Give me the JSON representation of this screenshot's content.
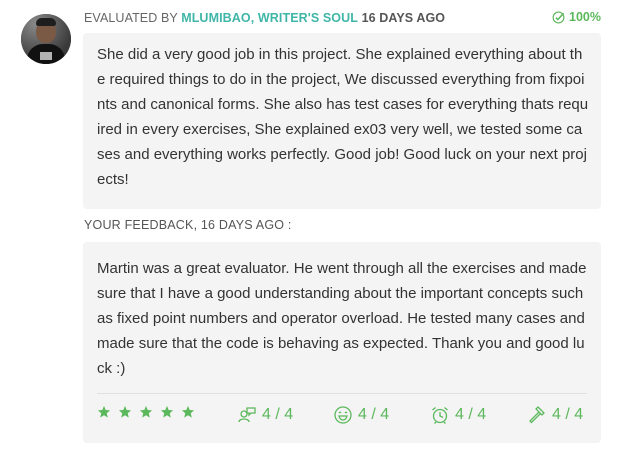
{
  "evaluation": {
    "prefix": "EVALUATED BY",
    "evaluator": "MLUMIBAO, WRITER'S SOUL",
    "time_ago": "16 DAYS AGO",
    "score": "100%",
    "comment": "She did a very good job in this project. She explained everything about the required things to do in the project, We discussed everything from fixpoints and canonical forms. She also has test cases for everything thats required in every exercises, She explained ex03 very well, we tested some cases and everything works perfectly. Good job! Good luck on your next projects!"
  },
  "feedback": {
    "label": "YOUR FEEDBACK, 16 DAYS AGO :",
    "comment": "Martin was a great evaluator. He went through all the exercises and made sure that I have a good understanding about the important concepts such as fixed point numbers and operator overload. He tested many cases and made sure that the code is behaving as expected. Thank you and good luck :)",
    "stars": 5,
    "metrics": [
      {
        "icon": "talk-icon",
        "value": "4 / 4"
      },
      {
        "icon": "smiley-icon",
        "value": "4 / 4"
      },
      {
        "icon": "alarm-clock-icon",
        "value": "4 / 4"
      },
      {
        "icon": "gavel-icon",
        "value": "4 / 4"
      }
    ]
  },
  "colors": {
    "accent": "#3fb6a8",
    "positive": "#5cb85c",
    "bubble": "#f4f4f4"
  }
}
